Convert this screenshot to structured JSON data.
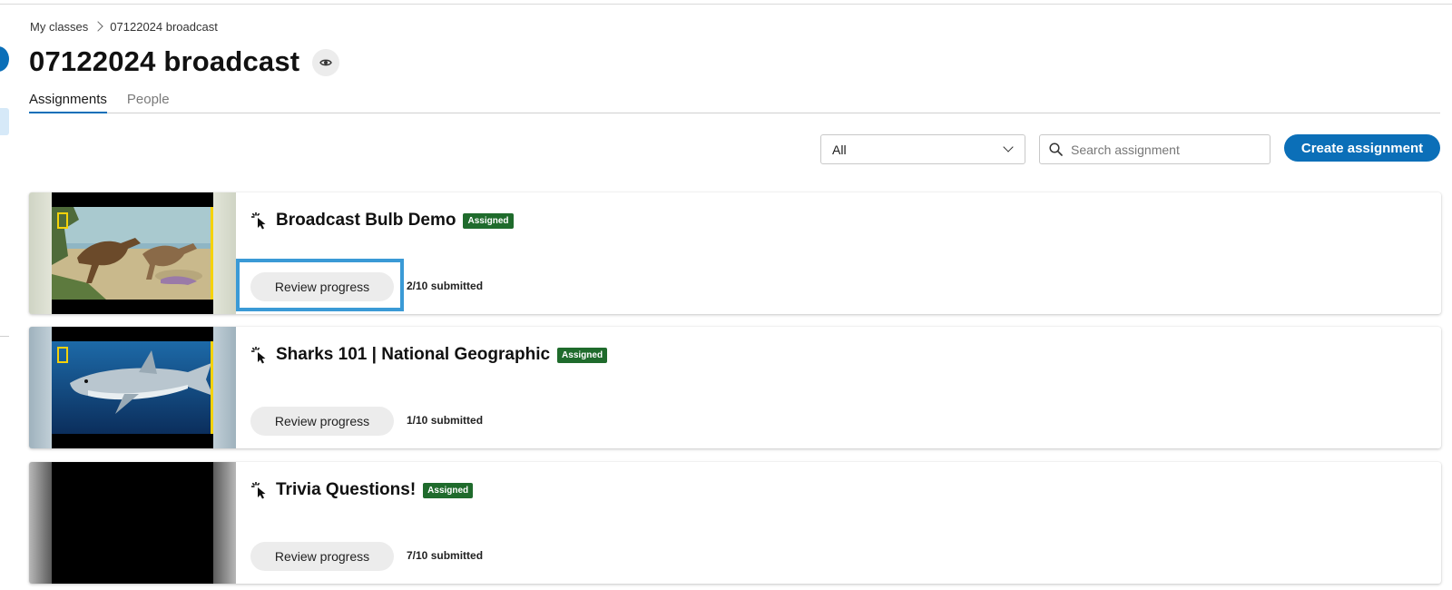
{
  "breadcrumb": {
    "root": "My classes",
    "current": "07122024 broadcast"
  },
  "page_title": "07122024 broadcast",
  "tabs": [
    {
      "label": "Assignments",
      "active": true
    },
    {
      "label": "People",
      "active": false
    }
  ],
  "toolbar": {
    "filter_value": "All",
    "search_placeholder": "Search assignment",
    "create_label": "Create assignment"
  },
  "assignments": [
    {
      "title": "Broadcast Bulb Demo",
      "status": "Assigned",
      "review_label": "Review progress",
      "submitted": "2/10 submitted",
      "thumbnail": "dinosaurs-scene",
      "focused": true
    },
    {
      "title": "Sharks 101 | National Geographic",
      "status": "Assigned",
      "review_label": "Review progress",
      "submitted": "1/10 submitted",
      "thumbnail": "shark-underwater",
      "focused": false
    },
    {
      "title": "Trivia Questions!",
      "status": "Assigned",
      "review_label": "Review progress",
      "submitted": "7/10 submitted",
      "thumbnail": "blank-black",
      "focused": false
    }
  ],
  "colors": {
    "accent": "#0b6fb8",
    "badge": "#1f6b2c",
    "focus": "#3a9ad6",
    "ng_yellow": "#f5d20a"
  },
  "icons": {
    "breadcrumb_separator": "chevron-right-icon",
    "visibility": "eye-icon",
    "filter_chevron": "chevron-down-icon",
    "search": "search-icon",
    "assignment_type": "cursor-click-icon",
    "brand": "national-geographic-logo"
  }
}
